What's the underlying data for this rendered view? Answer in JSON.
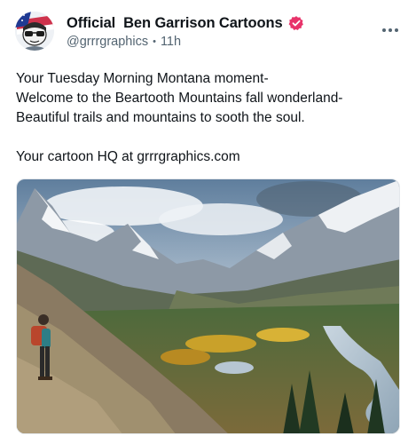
{
  "author": {
    "display_name": "Official  Ben Garrison Cartoons",
    "handle": "@grrrgraphics",
    "time": "11h",
    "verified_badge_color": "#e8336a"
  },
  "post": {
    "lines": [
      "Your Tuesday Morning Montana moment-",
      "Welcome to the Beartooth Mountains fall wonderland-",
      "Beautiful trails and mountains to sooth the soul.",
      "Your cartoon HQ at grrrgraphics.com"
    ]
  },
  "media": {
    "subject": "hiker on a trail overlooking a valley with snow-capped mountains, autumn trees and a winding river"
  },
  "icons": {
    "avatar": "cartoon-avatar-icon",
    "verified": "verified-badge-icon",
    "more": "more-options-icon"
  },
  "colors": {
    "text": "#0f1419",
    "secondary_text": "#536471"
  }
}
